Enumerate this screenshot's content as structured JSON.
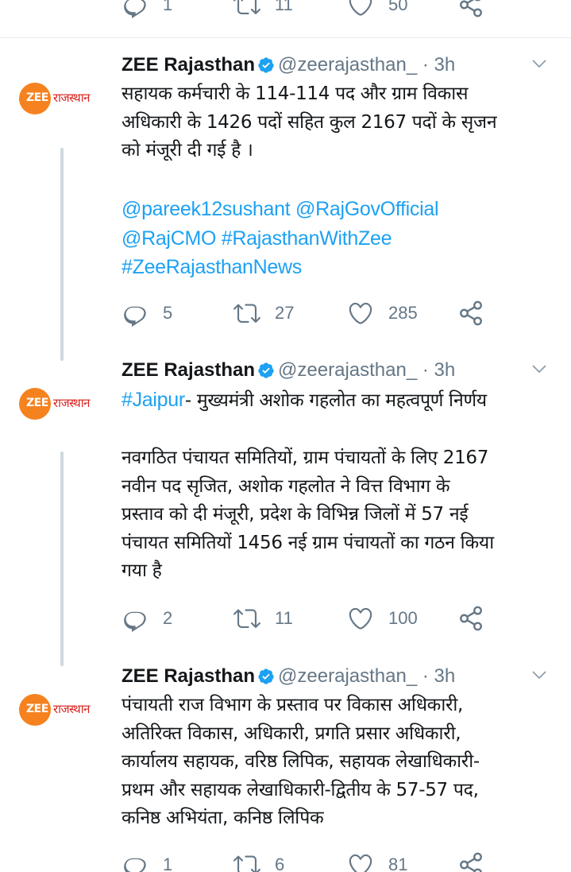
{
  "colors": {
    "link": "#1da1f2",
    "muted": "#657786",
    "brand_orange": "#f5821f",
    "brand_red": "#d9201c"
  },
  "prev_tweet": {
    "replies": "1",
    "retweets": "11",
    "likes": "50"
  },
  "account": {
    "name": "ZEE Rajasthan",
    "handle": "@zeerajasthan_ · 3h",
    "avatar_zee": "ZEE",
    "avatar_text": "राजस्थान"
  },
  "tweets": [
    {
      "text": "सहायक कर्मचारी के 114-114 पद और ग्राम विकास\nअधिकारी के 1426 पदों सहित कुल 2167 पदों के सृजन\nको मंजूरी दी गई है ।",
      "tags": [
        "@pareek12sushant @RajGovOfficial",
        "@RajCMO #RajasthanWithZee",
        "#ZeeRajasthanNews"
      ],
      "replies": "5",
      "retweets": "27",
      "likes": "285"
    },
    {
      "hashtag": "#Jaipur",
      "text_first": "- मुख्यमंत्री अशोक गहलोत का महत्वपूर्ण निर्णय",
      "text": "नवगठित पंचायत समितियों, ग्राम पंचायतों के लिए 2167\nनवीन पद सृजित, अशोक गहलोत ने वित्त विभाग के\nप्रस्ताव को दी मंजूरी, प्रदेश के विभिन्न जिलों में 57 नई\nपंचायत समितियों 1456 नई ग्राम पंचायतों का गठन किया\nगया है",
      "replies": "2",
      "retweets": "11",
      "likes": "100"
    },
    {
      "text": "पंचायती राज विभाग के प्रस्ताव पर विकास अधिकारी,\nअतिरिक्त विकास, अधिकारी, प्रगति प्रसार अधिकारी,\nकार्यालय सहायक, वरिष्ठ लिपिक, सहायक लेखाधिकारी-\nप्रथम और सहायक लेखाधिकारी-द्वितीय के 57-57 पद,\nकनिष्ठ अभियंता, कनिष्ठ लिपिक",
      "replies": "1",
      "retweets": "6",
      "likes": "81"
    }
  ]
}
